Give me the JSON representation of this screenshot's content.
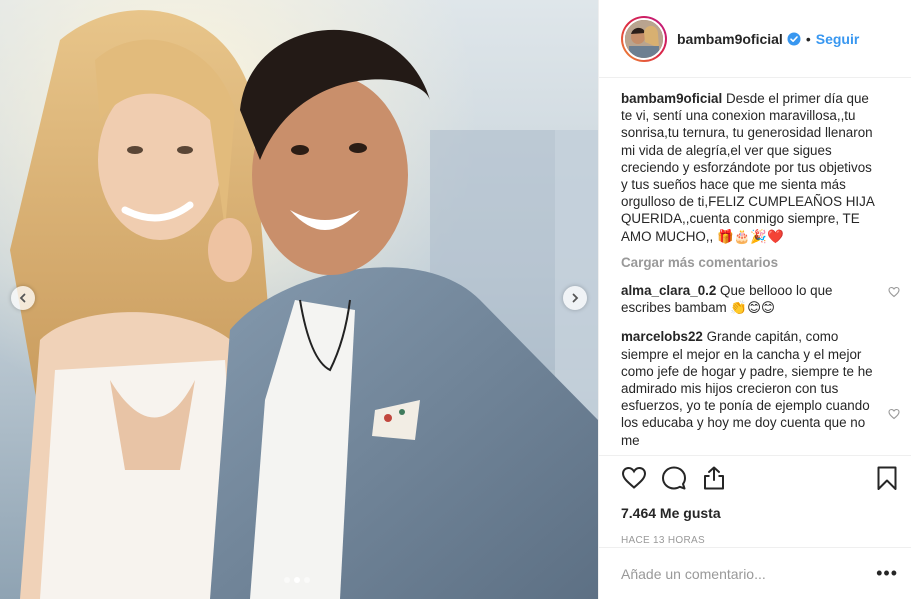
{
  "post": {
    "username": "bambam9oficial",
    "verified": true,
    "separator": "•",
    "follow_label": "Seguir",
    "caption_user": "bambam9oficial",
    "caption_text": "Desde el primer día que te vi, sentí una conexion maravillosa,,tu sonrisa,tu ternura, tu generosidad llenaron mi vida de alegría,el ver que sigues creciendo y esforzándote por tus objetivos y tus sueños hace que me sienta más orgulloso de ti,FELIZ CUMPLEAÑOS HIJA QUERIDA,,cuenta conmigo siempre, TE AMO MUCHO,, 🎁🎂🎉❤️",
    "load_more_label": "Cargar más comentarios",
    "comments": [
      {
        "user": "alma_clara_0.2",
        "text": "Que bellooo lo que escribes bambam 👏😊😊"
      },
      {
        "user": "marcelobs22",
        "text": "Grande capitán, como siempre el mejor en la cancha y el mejor como jefe de hogar y padre, siempre te he admirado mis hijos crecieron con tus esfuerzos, yo te ponía de ejemplo cuando los educaba y hoy me doy cuenta que no me"
      }
    ],
    "likes_label": "7.464 Me gusta",
    "timestamp": "HACE 13 HORAS",
    "comment_placeholder": "Añade un comentario...",
    "more_options": "•••"
  },
  "carousel": {
    "total_slides": 3,
    "active_slide": 2
  },
  "icons": {
    "prev": "chevron-left-icon",
    "next": "chevron-right-icon",
    "verified": "verified-badge-icon",
    "like": "heart-icon",
    "comment": "comment-bubble-icon",
    "share": "share-icon",
    "save": "bookmark-icon"
  },
  "colors": {
    "link_blue": "#3897f0",
    "muted_gray": "#999999",
    "text": "#262626",
    "divider": "#efefef"
  }
}
